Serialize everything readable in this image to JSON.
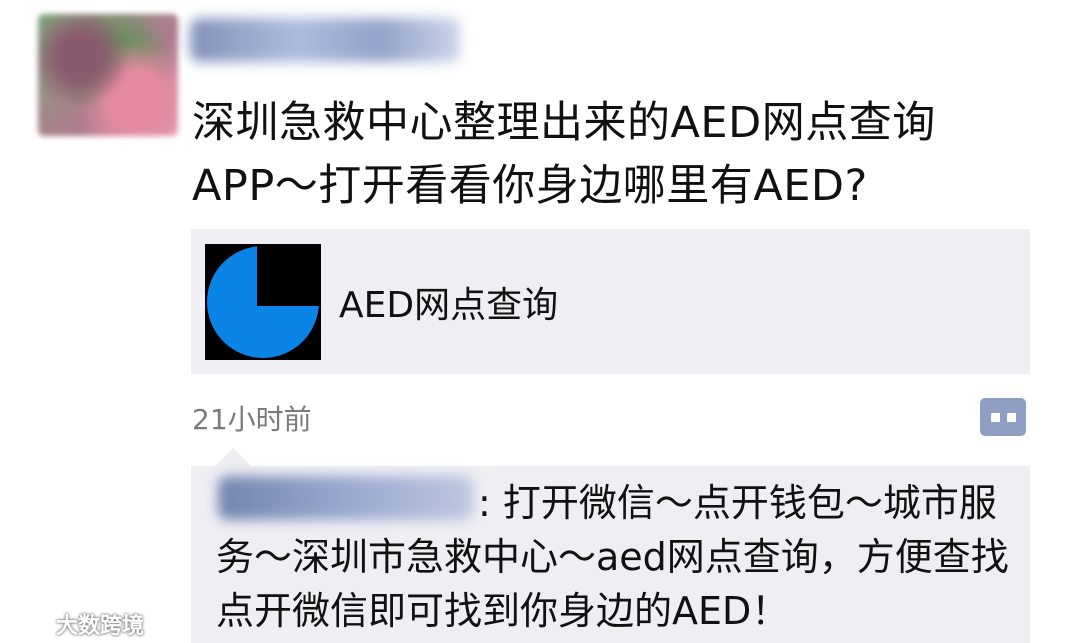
{
  "post": {
    "text_line1": "深圳急救中心整理出来的AED网点查询",
    "text_line2": "APP～打开看看你身边哪里有AED?",
    "timestamp": "21小时前"
  },
  "link_card": {
    "title": "AED网点查询",
    "icon": "pie-chart-icon",
    "icon_color": "#0a84e6"
  },
  "comment": {
    "text": ": 打开微信～点开钱包～城市服务～深圳市急救中心～aed网点查询，方便查找点开微信即可找到你身边的AED！"
  },
  "watermark": {
    "text": "大数跨境"
  },
  "colors": {
    "card_background": "#eeeef3",
    "comment_button": "#8f9fc4",
    "timestamp": "#7b7b7b"
  }
}
